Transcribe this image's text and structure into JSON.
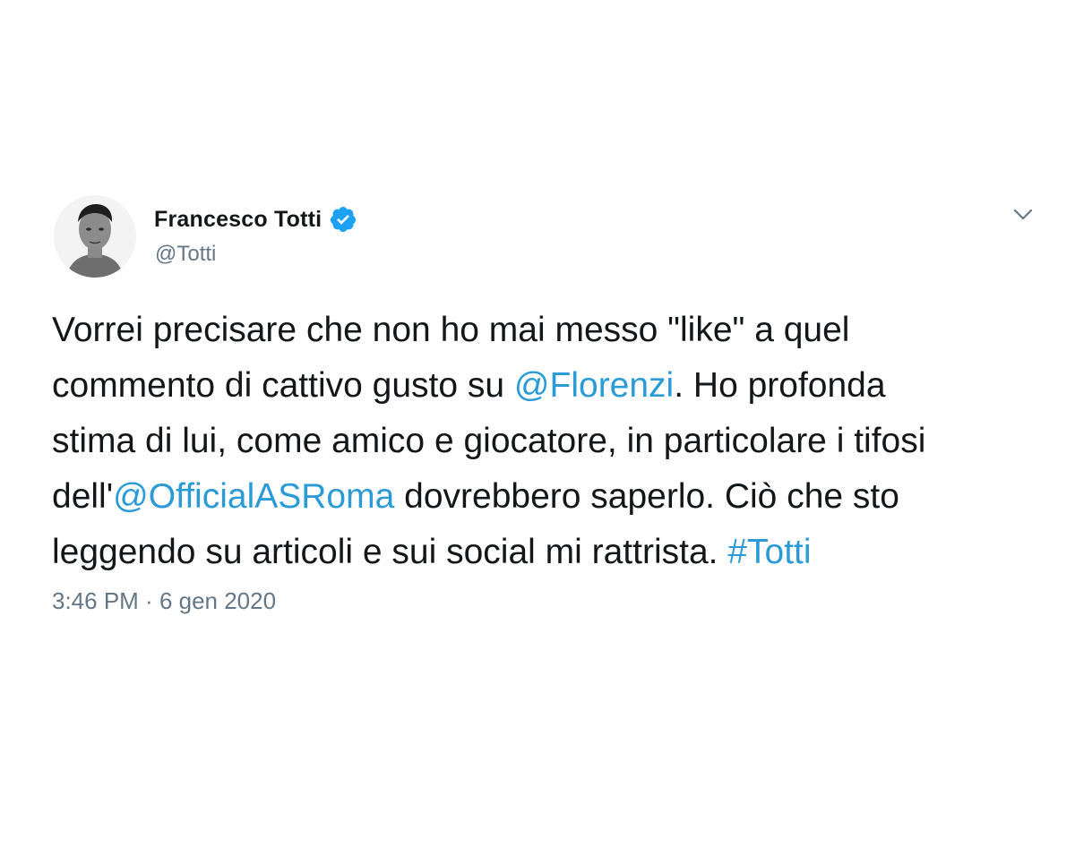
{
  "author": {
    "display_name": "Francesco Totti",
    "handle": "@Totti",
    "verified_icon": "verified-badge-icon"
  },
  "tweet": {
    "lines": [
      [
        {
          "t": "Vorrei precisare che non ho mai messo \"like\" a quel"
        }
      ],
      [
        {
          "t": "commento di cattivo gusto su "
        },
        {
          "t": "@Florenzi"
        },
        {
          "t": ". Ho profonda"
        }
      ],
      [
        {
          "t": "stima di lui, come amico e giocatore, in particolare i tifosi"
        }
      ],
      [
        {
          "t": "dell'"
        },
        {
          "t": "@OfficialASRoma"
        },
        {
          "t": " dovrebbero saperlo. Ciò che sto"
        }
      ],
      [
        {
          "t": "leggendo su articoli e sui social mi rattrista. "
        },
        {
          "t": "#Totti"
        }
      ]
    ],
    "time": "3:46 PM",
    "separator": " · ",
    "date": "6 gen 2020"
  },
  "colors": {
    "link": "#2b9bd8",
    "verified": "#1da1f2",
    "secondary_text": "#657786"
  },
  "icons": {
    "menu": "chevron-down-icon"
  }
}
